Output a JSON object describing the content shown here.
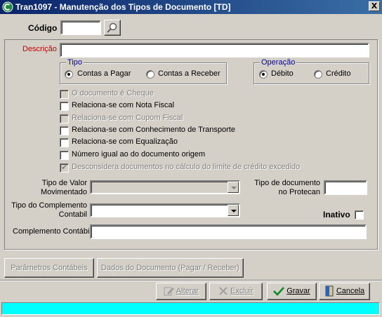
{
  "window": {
    "title": "Tran1097 - Manutenção dos Tipos de Documento [TD]",
    "close_glyph": "X"
  },
  "codigo": {
    "label": "Código",
    "value": ""
  },
  "descricao": {
    "label": "Descrição",
    "value": ""
  },
  "tipo": {
    "legend": "Tipo",
    "options": [
      "Contas a Pagar",
      "Contas a Receber"
    ],
    "selected": "Contas a Pagar"
  },
  "operacao": {
    "legend": "Operação",
    "options": [
      "Débito",
      "Crédito"
    ],
    "selected": "Débito"
  },
  "checkboxes": [
    {
      "label": "O documento é Cheque",
      "checked": false,
      "enabled": false
    },
    {
      "label": "Relaciona-se com Nota Fiscal",
      "checked": false,
      "enabled": true
    },
    {
      "label": "Relaciona-se com Cupom Fiscal",
      "checked": false,
      "enabled": false
    },
    {
      "label": "Relaciona-se com Conhecimento de Transporte",
      "checked": false,
      "enabled": true
    },
    {
      "label": "Relaciona-se com Equalização",
      "checked": false,
      "enabled": true
    },
    {
      "label": "Número igual ao do documento origem",
      "checked": false,
      "enabled": true
    },
    {
      "label": "Desconsidera documentos no cálculo do limite de crédito excedido",
      "checked": true,
      "enabled": false
    }
  ],
  "tipo_valor": {
    "label_line1": "Tipo de Valor",
    "label_line2": "Movimentado",
    "value": ""
  },
  "tipo_doc_protecan": {
    "label_line1": "Tipo de documento",
    "label_line2": "no Protecan",
    "value": ""
  },
  "tipo_complemento": {
    "label_line1": "Tipo do Complemento",
    "label_line2": "Contabil",
    "value": ""
  },
  "inativo": {
    "label": "Inativo",
    "checked": false
  },
  "complemento_contabil": {
    "label": "Complemento Contábil",
    "value": ""
  },
  "tabs": {
    "parametros": "Parâmetros Contábeis",
    "dados": "Dados do Documento (Pagar / Receber)"
  },
  "actions": {
    "alterar": "Alterar",
    "excluir": "Excluir",
    "gravar": "Gravar",
    "cancela": "Cancela"
  },
  "colors": {
    "title_start": "#0a246a",
    "title_end": "#3a6ea5",
    "required_label": "#c00000",
    "group_legend": "#0000c0",
    "status_bar": "#00ffff"
  },
  "icons": {
    "app": "app-icon",
    "search": "magnifier-icon",
    "alterar": "pencil-icon",
    "excluir": "x-icon",
    "gravar": "checkmark-icon",
    "cancela": "door-icon"
  }
}
